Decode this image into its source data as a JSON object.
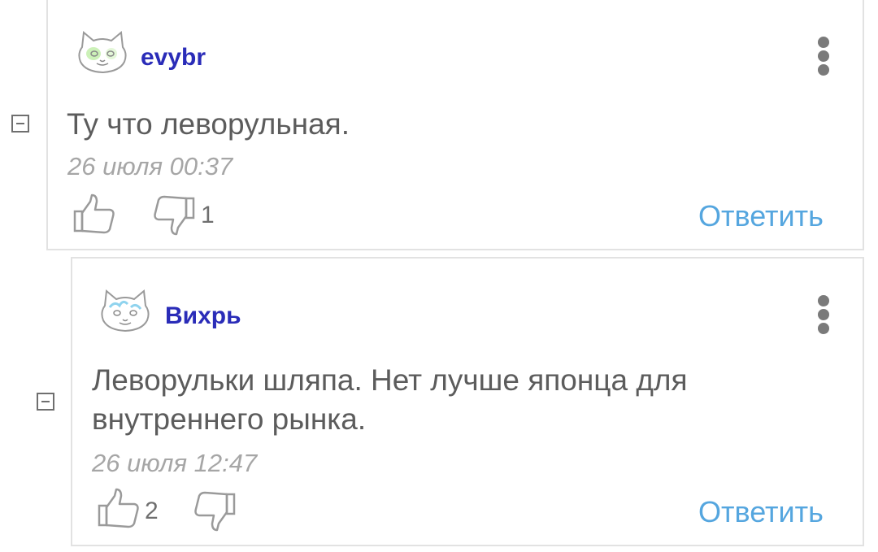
{
  "comments": [
    {
      "username": "evybr",
      "avatar_icon": "cat-avatar-icon",
      "avatar_accent": "#9ee07a",
      "text": "Ту что леворульная.",
      "date": "26 июля 00:37",
      "likes": "",
      "dislikes": "1",
      "reply_label": "Ответить"
    },
    {
      "username": "Вихрь",
      "avatar_icon": "cat-avatar-icon",
      "avatar_accent": "#8fd3ee",
      "text_lines": [
        "Леворульки шляпа. Нет лучше японца для",
        "внутреннего рынка."
      ],
      "date": "26 июля 12:47",
      "likes": "2",
      "dislikes": "",
      "reply_label": "Ответить"
    }
  ],
  "colors": {
    "username": "#2a2cb8",
    "reply": "#55a6df",
    "text": "#5c5c5c",
    "date": "#a6a6a6",
    "border": "#e2e2e2"
  }
}
